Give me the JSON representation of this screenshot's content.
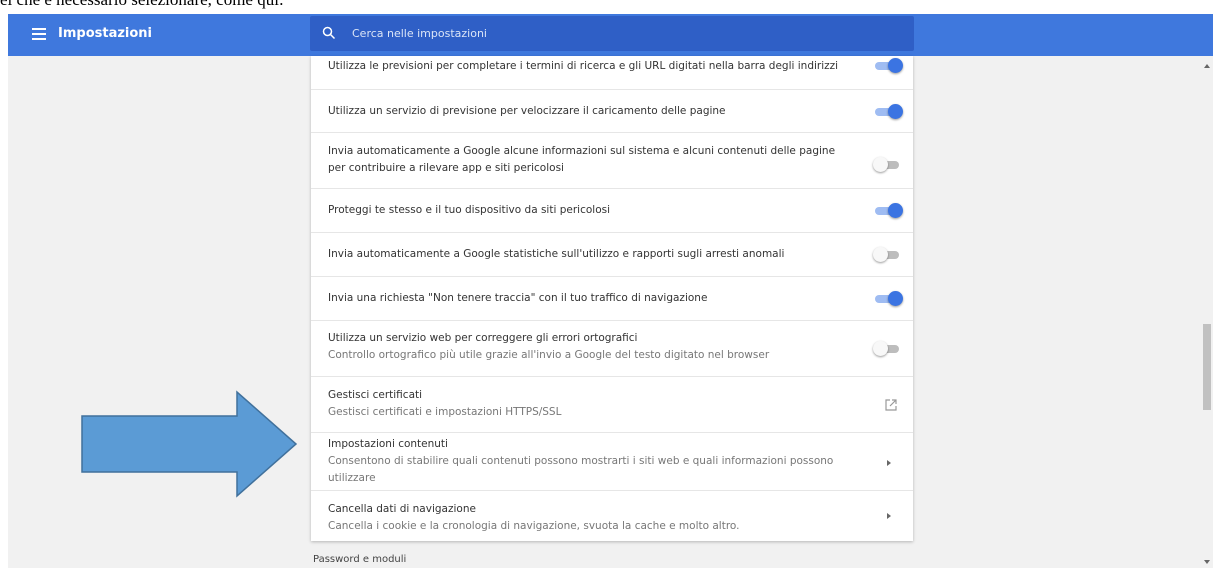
{
  "caption": "ei che è necessario selezionare, come qui:",
  "header": {
    "title": "Impostazioni",
    "search_placeholder": "Cerca nelle impostazioni"
  },
  "settings": [
    {
      "title": "Utilizza le previsioni per completare i termini di ricerca e gli URL digitati nella barra degli indirizzi",
      "control": "toggle",
      "state": "on"
    },
    {
      "title": "Utilizza un servizio di previsione per velocizzare il caricamento delle pagine",
      "control": "toggle",
      "state": "on"
    },
    {
      "title": "Invia automaticamente a Google alcune informazioni sul sistema e alcuni contenuti delle pagine per contribuire a rilevare app e siti pericolosi",
      "control": "toggle",
      "state": "off"
    },
    {
      "title": "Proteggi te stesso e il tuo dispositivo da siti pericolosi",
      "control": "toggle",
      "state": "on"
    },
    {
      "title": "Invia automaticamente a Google statistiche sull'utilizzo e rapporti sugli arresti anomali",
      "control": "toggle",
      "state": "off"
    },
    {
      "title": "Invia una richiesta \"Non tenere traccia\" con il tuo traffico di navigazione",
      "control": "toggle",
      "state": "on"
    },
    {
      "title": "Utilizza un servizio web per correggere gli errori ortografici",
      "subtitle": "Controllo ortografico più utile grazie all'invio a Google del testo digitato nel browser",
      "control": "toggle",
      "state": "off"
    },
    {
      "title": "Gestisci certificati",
      "subtitle": "Gestisci certificati e impostazioni HTTPS/SSL",
      "control": "external-link-icon"
    },
    {
      "title": "Impostazioni contenuti",
      "subtitle": "Consentono di stabilire quali contenuti possono mostrarti i siti web e quali informazioni possono utilizzare",
      "control": "chevron-right-icon"
    },
    {
      "title": "Cancella dati di navigazione",
      "subtitle": "Cancella i cookie e la cronologia di navigazione, svuota la cache e molto altro.",
      "control": "chevron-right-icon"
    }
  ],
  "next_section": "Password e moduli",
  "colors": {
    "header": "#3f78dd",
    "search_box": "#2f5fc6",
    "toggle_on": "#3b74e2",
    "arrow_fill": "#5b9bd5",
    "arrow_stroke": "#41719c"
  }
}
